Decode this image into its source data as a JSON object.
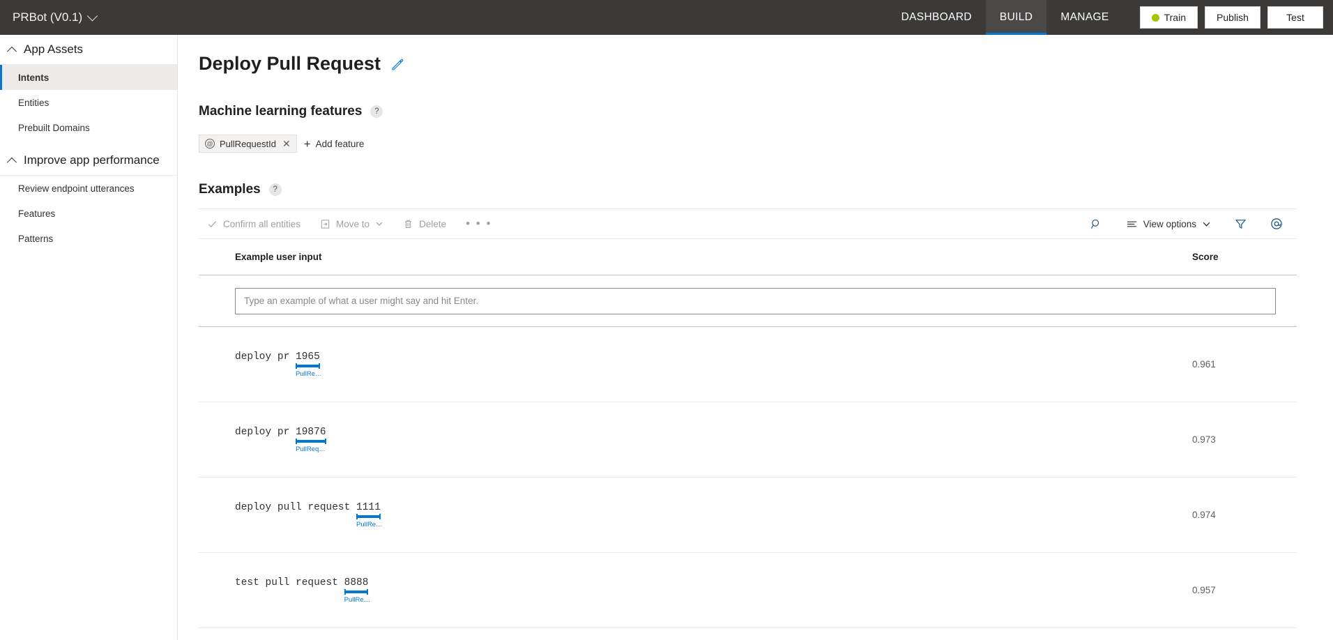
{
  "header": {
    "app_title": "PRBot (V0.1)",
    "app_chevron_icon": "chevron-down-icon",
    "nav": [
      {
        "label": "DASHBOARD",
        "active": false
      },
      {
        "label": "BUILD",
        "active": true
      },
      {
        "label": "MANAGE",
        "active": false
      }
    ],
    "buttons": {
      "train": "Train",
      "train_status_color": "#a4c400",
      "publish": "Publish",
      "test": "Test"
    },
    "background_color": "#3b3a39",
    "active_tab_accent": "#0078d4"
  },
  "sidebar": {
    "groups": [
      {
        "label": "App Assets",
        "icon": "chevron-up-icon",
        "items": [
          {
            "label": "Intents",
            "selected": true
          },
          {
            "label": "Entities",
            "selected": false
          },
          {
            "label": "Prebuilt Domains",
            "selected": false
          }
        ]
      },
      {
        "label": "Improve app performance",
        "icon": "chevron-up-icon",
        "items": [
          {
            "label": "Review endpoint utterances",
            "selected": false
          },
          {
            "label": "Features",
            "selected": false
          },
          {
            "label": "Patterns",
            "selected": false
          }
        ]
      }
    ],
    "selected_accent": "#0078d4"
  },
  "main": {
    "page_title": "Deploy Pull Request",
    "edit_icon": "pencil-icon",
    "ml_features": {
      "title": "Machine learning features",
      "help_icon": "help-icon",
      "help_label": "?",
      "chips": [
        {
          "prefix_icon": "at-icon",
          "prefix": "@",
          "label": "PullRequestId",
          "remove_icon": "close-icon",
          "remove_label": "✕"
        }
      ],
      "add_feature_label": "Add feature",
      "add_feature_icon": "plus-icon",
      "add_feature_glyph": "+"
    },
    "examples": {
      "title": "Examples",
      "help_icon": "help-icon",
      "help_label": "?",
      "toolbar": {
        "confirm_all_entities": "Confirm all entities",
        "confirm_icon": "checkmark-icon",
        "move_to": "Move to",
        "move_to_icon": "move-to-icon",
        "move_to_chevron_icon": "chevron-down-icon",
        "delete": "Delete",
        "delete_icon": "trash-icon",
        "overflow": "• • •",
        "overflow_icon": "more-icon",
        "search_icon": "search-icon",
        "view_options": "View options",
        "view_options_icon": "list-icon",
        "view_options_chevron_icon": "chevron-down-icon",
        "filter_icon": "filter-icon",
        "entity_icon": "at-icon"
      },
      "columns": {
        "utterance": "Example user input",
        "score": "Score"
      },
      "new_utterance_placeholder": "Type an example of what a user might say and hit Enter.",
      "new_utterance_value": "",
      "entity_accent_color": "#0078d4",
      "rows": [
        {
          "prefix": "deploy pr ",
          "entity_text": "1965",
          "entity_label": "PullRe…",
          "score": "0.961"
        },
        {
          "prefix": "deploy pr ",
          "entity_text": "19876",
          "entity_label": "PullReq…",
          "score": "0.973"
        },
        {
          "prefix": "deploy pull request ",
          "entity_text": "1111",
          "entity_label": "PullRe…",
          "score": "0.974"
        },
        {
          "prefix": "test pull request ",
          "entity_text": "8888",
          "entity_label": "PullRe…",
          "score": "0.957"
        }
      ]
    }
  }
}
